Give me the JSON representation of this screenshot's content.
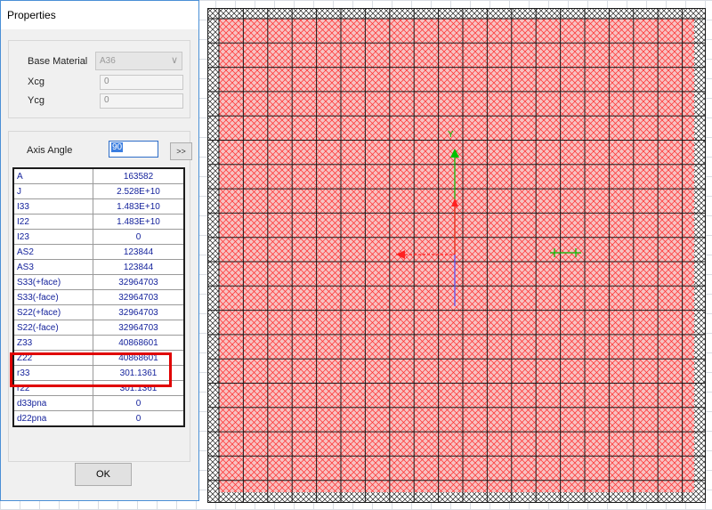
{
  "window": {
    "title": "Properties"
  },
  "material": {
    "base_material_label": "Base Material",
    "base_material_value": "A36",
    "xcg_label": "Xcg",
    "xcg_value": "0",
    "ycg_label": "Ycg",
    "ycg_value": "0"
  },
  "axis": {
    "label": "Axis Angle",
    "value": "90",
    "more_label": ">>"
  },
  "properties": [
    {
      "name": "A",
      "value": "163582"
    },
    {
      "name": "J",
      "value": "2.528E+10"
    },
    {
      "name": "I33",
      "value": "1.483E+10"
    },
    {
      "name": "I22",
      "value": "1.483E+10"
    },
    {
      "name": "I23",
      "value": "0"
    },
    {
      "name": "AS2",
      "value": "123844"
    },
    {
      "name": "AS3",
      "value": "123844"
    },
    {
      "name": "S33(+face)",
      "value": "32964703"
    },
    {
      "name": "S33(-face)",
      "value": "32964703"
    },
    {
      "name": "S22(+face)",
      "value": "32964703"
    },
    {
      "name": "S22(-face)",
      "value": "32964703"
    },
    {
      "name": "Z33",
      "value": "40868601"
    },
    {
      "name": "Z22",
      "value": "40868601"
    },
    {
      "name": "r33",
      "value": "301.1361"
    },
    {
      "name": "r22",
      "value": "301.1361"
    },
    {
      "name": "d33pna",
      "value": "0"
    },
    {
      "name": "d22pna",
      "value": "0"
    }
  ],
  "buttons": {
    "ok": "OK"
  },
  "canvas": {
    "axis_y_label": "Y",
    "axis_x_label": "X",
    "hatch_color": "#ff2020",
    "fill_color": "#f6b6b6"
  }
}
